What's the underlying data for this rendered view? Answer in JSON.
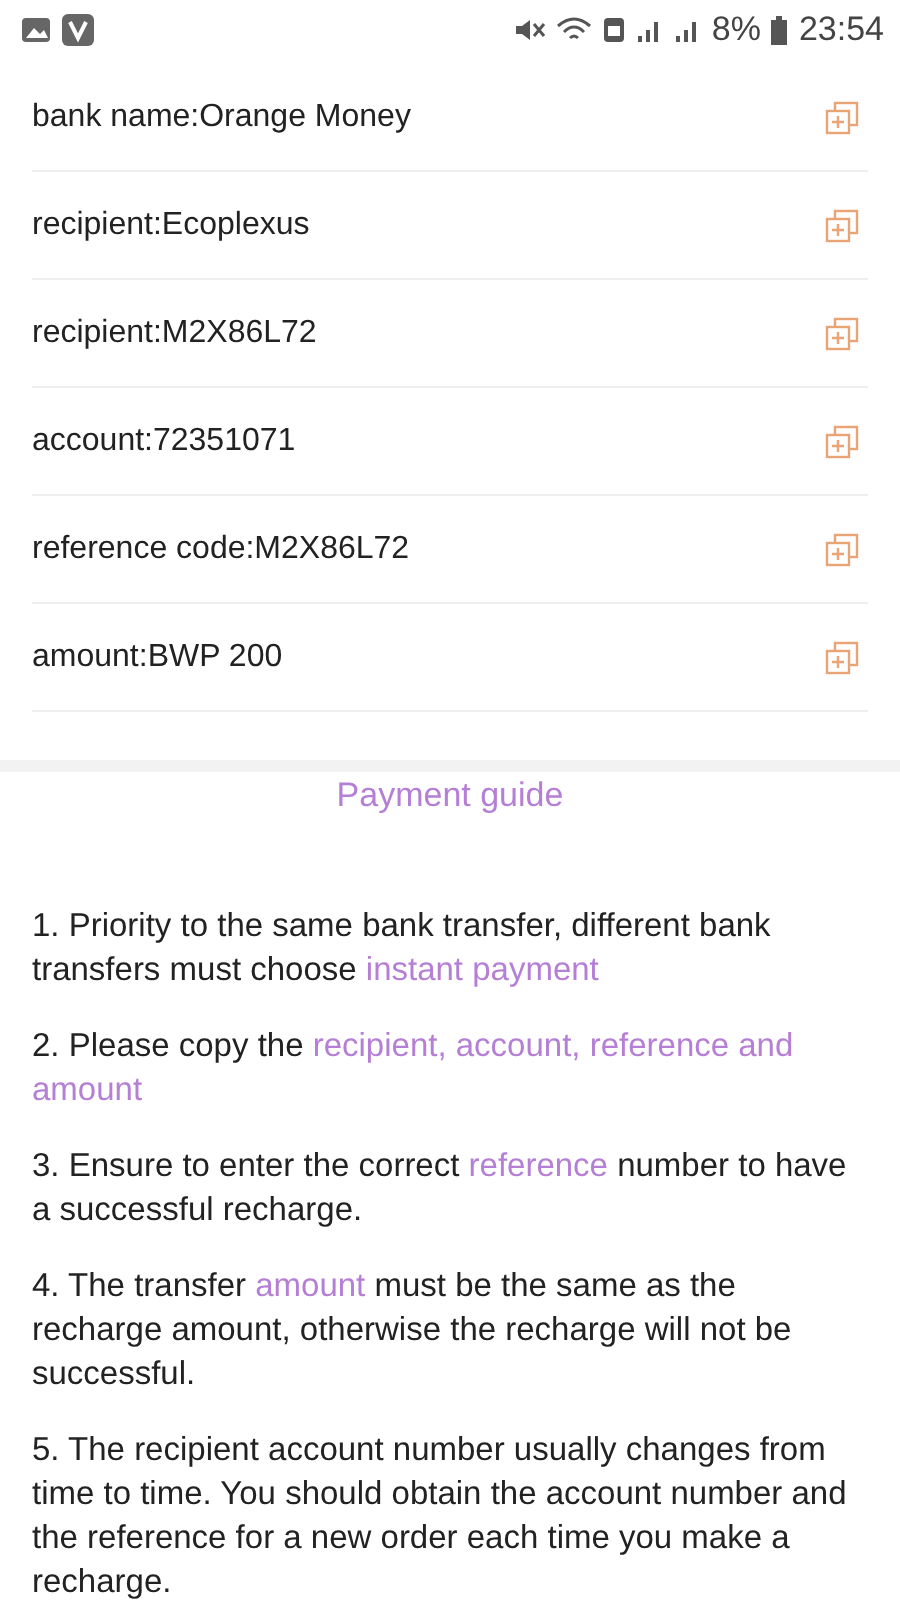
{
  "status_bar": {
    "battery": "8%",
    "time": "23:54"
  },
  "details": [
    {
      "label": "bank name:Orange Money"
    },
    {
      "label": "recipient:Ecoplexus"
    },
    {
      "label": "recipient:M2X86L72"
    },
    {
      "label": "account:72351071"
    },
    {
      "label": "reference code:M2X86L72"
    },
    {
      "label": "amount:BWP 200"
    }
  ],
  "guide": {
    "title": "Payment guide",
    "steps": [
      [
        {
          "text": "1. Priority to the same bank transfer, different bank transfers must choose ",
          "highlight": false
        },
        {
          "text": "instant payment",
          "highlight": true
        }
      ],
      [
        {
          "text": "2. Please copy the ",
          "highlight": false
        },
        {
          "text": "recipient, account, reference and amount",
          "highlight": true
        }
      ],
      [
        {
          "text": "3. Ensure to enter the correct ",
          "highlight": false
        },
        {
          "text": "reference",
          "highlight": true
        },
        {
          "text": " number to have a successful recharge.",
          "highlight": false
        }
      ],
      [
        {
          "text": "4. The transfer ",
          "highlight": false
        },
        {
          "text": "amount",
          "highlight": true
        },
        {
          "text": " must be the same as the recharge amount, otherwise the recharge will not be successful.",
          "highlight": false
        }
      ],
      [
        {
          "text": "5. The recipient account number usually changes from time to time. You should obtain the account number and the reference for a new order each time you make a recharge.",
          "highlight": false
        }
      ]
    ]
  }
}
